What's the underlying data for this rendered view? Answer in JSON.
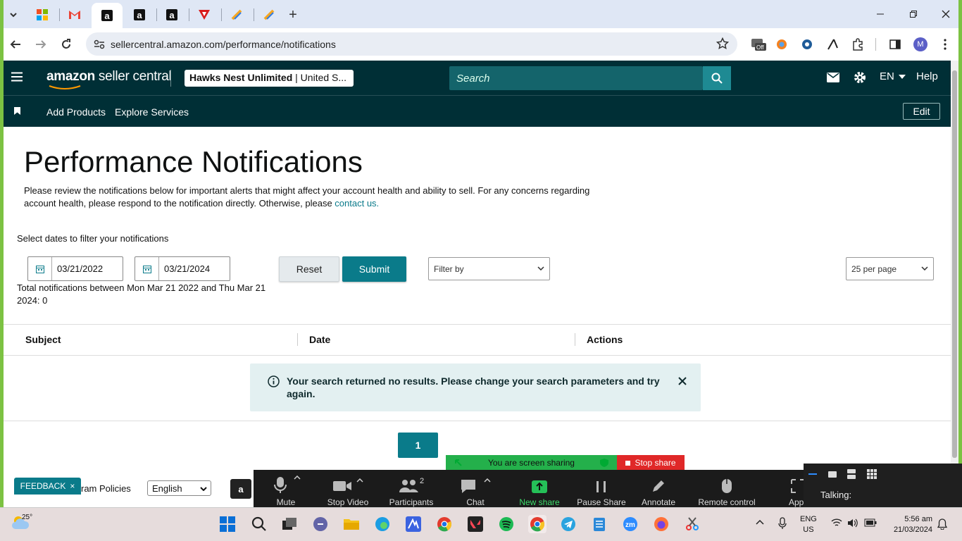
{
  "browser": {
    "url": "sellercentral.amazon.com/performance/notifications",
    "tab_icons": [
      "windows-icon",
      "gmail-icon",
      "amazon-icon",
      "amazon-icon",
      "amazon-icon",
      "red-triangle-icon",
      "tasks-icon",
      "tasks-icon"
    ],
    "new_tab_label": "+"
  },
  "header": {
    "logo_bold": "amazon",
    "logo_rest": " seller central",
    "store_bold": "Hawks Nest Unlimited",
    "store_rest": " | United S...",
    "search_placeholder": "Search",
    "lang": "EN",
    "help": "Help"
  },
  "subnav": {
    "items": [
      "Add Products",
      "Explore Services"
    ],
    "edit": "Edit"
  },
  "main": {
    "title": "Performance Notifications",
    "desc_part1": "Please review the notifications below for important alerts that might affect your account health and ability to sell. For any concerns regarding account health, please respond to the notification directly. Otherwise, please ",
    "desc_link": "contact us.",
    "select_label": "Select dates to filter your notifications",
    "date_from": "03/21/2022",
    "date_to": "03/21/2024",
    "reset": "Reset",
    "submit": "Submit",
    "filter_placeholder": "Filter by",
    "per_page": "25 per page",
    "total": "Total notifications between Mon Mar 21 2022 and Thu Mar 21 2024: 0"
  },
  "table": {
    "headers": [
      "Subject",
      "Date",
      "Actions"
    ],
    "alert": "Your search returned no results. Please change your search parameters and try again.",
    "page": "1"
  },
  "footer": {
    "feedback": "FEEDBACK",
    "policies": "ram Policies",
    "language": "English"
  },
  "zoom": {
    "sharing": "You are screen sharing",
    "stop_share": "Stop share",
    "buttons": [
      "Mute",
      "Stop Video",
      "Participants",
      "Chat",
      "New share",
      "Pause Share",
      "Annotate",
      "Remote control",
      "App"
    ],
    "participants_count": "2",
    "avatar_letter": "M",
    "talking": "Talking:"
  },
  "taskbar": {
    "temp": "25°",
    "lang1": "ENG",
    "lang2": "US",
    "time": "5:56 am",
    "date": "21/03/2024"
  },
  "colors": {
    "header": "#002f36",
    "accent": "#0a7b8a",
    "alert_bg": "#e3f0f1"
  }
}
